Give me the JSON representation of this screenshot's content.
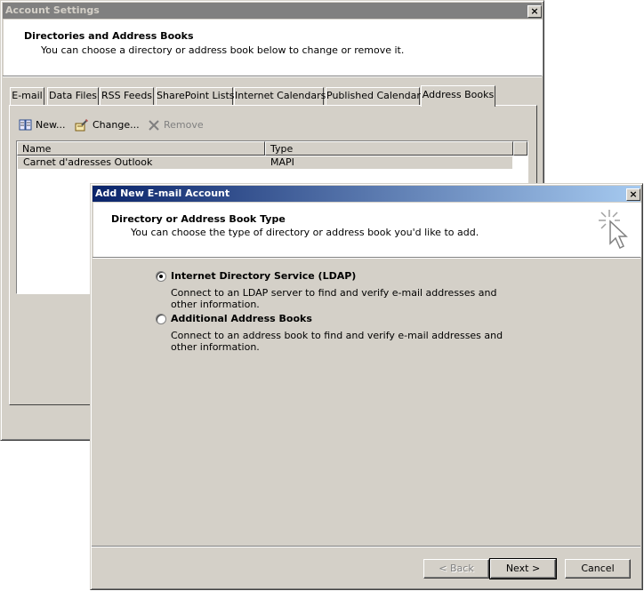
{
  "back_window": {
    "title": "Account Settings",
    "close_label": "×",
    "banner": {
      "heading": "Directories and Address Books",
      "subtitle": "You can choose a directory or address book below to change or remove it."
    },
    "tabs": [
      {
        "label": "E-mail"
      },
      {
        "label": "Data Files"
      },
      {
        "label": "RSS Feeds"
      },
      {
        "label": "SharePoint Lists"
      },
      {
        "label": "Internet Calendars"
      },
      {
        "label": "Published Calendars"
      },
      {
        "label": "Address Books"
      }
    ],
    "toolbar": {
      "new_label": "New...",
      "change_label": "Change...",
      "remove_label": "Remove"
    },
    "list": {
      "columns": [
        "Name",
        "Type"
      ],
      "rows": [
        {
          "name": "Carnet d'adresses Outlook",
          "type": "MAPI"
        }
      ]
    }
  },
  "dialog": {
    "title": "Add New E-mail Account",
    "close_label": "×",
    "banner": {
      "heading": "Directory or Address Book Type",
      "subtitle": "You can choose the type of directory or address book you'd like to add."
    },
    "options": [
      {
        "label": "Internet Directory Service (LDAP)",
        "description": "Connect to an LDAP server to find and verify e-mail addresses and other information.",
        "selected": true
      },
      {
        "label": "Additional Address Books",
        "description": "Connect to an address book to find and verify e-mail addresses and other information.",
        "selected": false
      }
    ],
    "buttons": {
      "back": "< Back",
      "next": "Next >",
      "cancel": "Cancel"
    }
  },
  "colors": {
    "window_face": "#d4d0c8",
    "title_active_start": "#0a246a",
    "title_active_end": "#a6caf0",
    "title_inactive": "#808080"
  }
}
